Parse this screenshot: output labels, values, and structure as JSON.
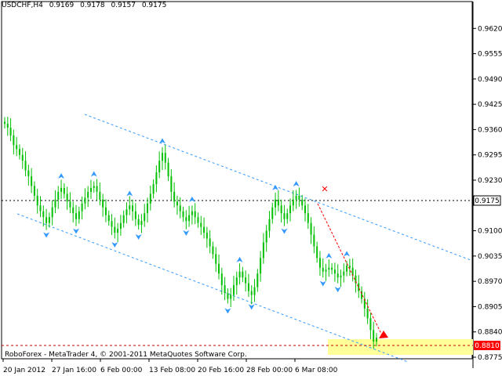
{
  "header": {
    "symbol_tf": "USDCHF,H4",
    "ohlc": [
      "0.9169",
      "0.9178",
      "0.9157",
      "0.9175"
    ]
  },
  "copyright": "RoboForex - MetaTrader 4, © 2001-2011 MetaQuotes Software Corp.",
  "colors": {
    "background": "#ffffff",
    "grid_dashes": "#000000",
    "candles": "#00c000",
    "channel": "#3399ff",
    "fractals": "#3399ff",
    "forecast_arrow": "#ff0000",
    "target_zone": "#ffff99",
    "price_label_bg": "#ff0000",
    "current_price_label_bg": "#ffffff"
  },
  "chart_data": {
    "type": "line",
    "title": "USDCHF,H4",
    "ylim": [
      0.8775,
      0.9685
    ],
    "y_ticks": [
      "0.9620",
      "0.9555",
      "0.9490",
      "0.9425",
      "0.9360",
      "0.9295",
      "0.9230",
      "0.9175",
      "0.9100",
      "0.9035",
      "0.8970",
      "0.8905",
      "0.8840",
      "0.8810",
      "0.8775"
    ],
    "x_ticks": [
      "20 Jan 2012",
      "27 Jan 16:00",
      "6 Feb 00:00",
      "13 Feb 08:00",
      "20 Feb 16:00",
      "28 Feb 00:00",
      "6 Mar 08:00"
    ],
    "current_price": "0.9175",
    "target_level": "0.8810",
    "series": [
      {
        "values": [
          0.9375,
          0.9365,
          0.9345,
          0.932,
          0.931,
          0.9295,
          0.928,
          0.9255,
          0.924,
          0.9215,
          0.919,
          0.9165,
          0.915,
          0.9135,
          0.912,
          0.9135,
          0.916,
          0.918,
          0.92,
          0.921,
          0.9195,
          0.9175,
          0.916,
          0.9145,
          0.913,
          0.915,
          0.917,
          0.9185,
          0.92,
          0.921,
          0.9215,
          0.92,
          0.918,
          0.916,
          0.914,
          0.9125,
          0.911,
          0.9095,
          0.9105,
          0.912,
          0.914,
          0.9155,
          0.9165,
          0.915,
          0.913,
          0.9115,
          0.9125,
          0.9145,
          0.917,
          0.9195,
          0.922,
          0.925,
          0.928,
          0.93,
          0.9275,
          0.924,
          0.92,
          0.9175,
          0.9165,
          0.915,
          0.9135,
          0.9125,
          0.914,
          0.915,
          0.9135,
          0.912,
          0.911,
          0.9095,
          0.908,
          0.906,
          0.904,
          0.9015,
          0.899,
          0.896,
          0.894,
          0.8925,
          0.8935,
          0.896,
          0.898,
          0.8995,
          0.898,
          0.8965,
          0.8945,
          0.8935,
          0.8955,
          0.899,
          0.903,
          0.907,
          0.91,
          0.913,
          0.916,
          0.918,
          0.9165,
          0.9145,
          0.913,
          0.9145,
          0.9165,
          0.918,
          0.919,
          0.918,
          0.9165,
          0.9145,
          0.912,
          0.909,
          0.906,
          0.903,
          0.9005,
          0.8995,
          0.9,
          0.9005,
          0.9,
          0.899,
          0.898,
          0.8985,
          0.8995,
          0.901,
          0.9005,
          0.8985,
          0.8965,
          0.8945,
          0.8925,
          0.89,
          0.8875,
          0.8845,
          0.8815,
          0.8825
        ]
      }
    ]
  }
}
